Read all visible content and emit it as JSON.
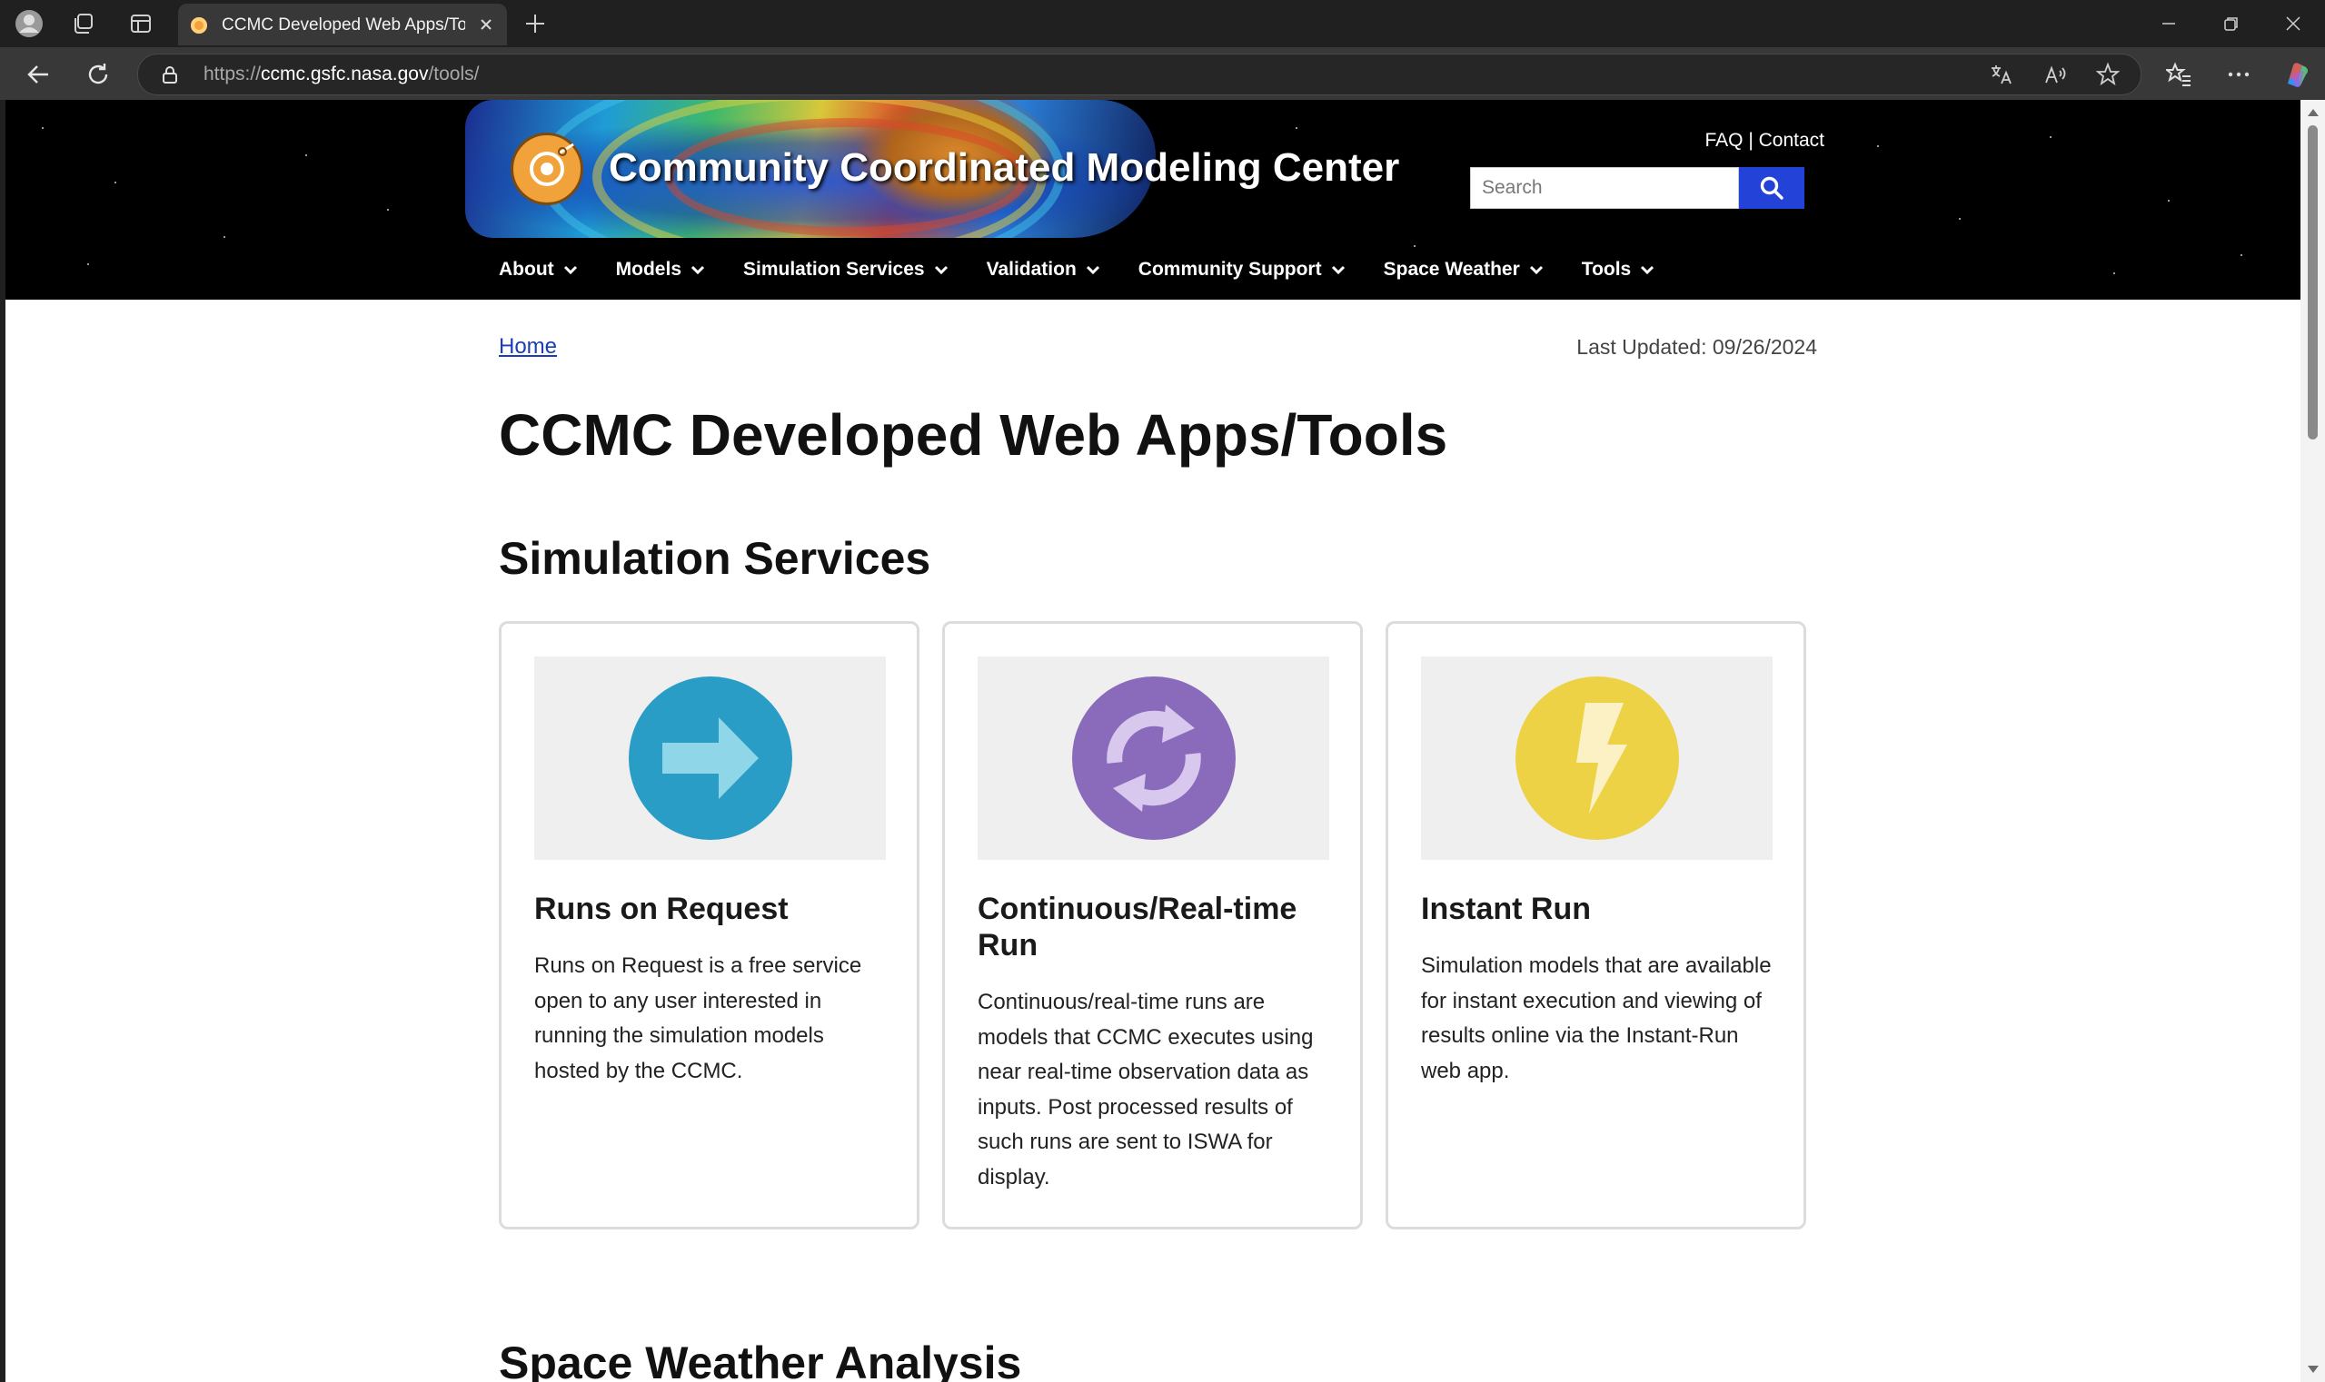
{
  "browser": {
    "tab_title": "CCMC Developed Web Apps/Tools",
    "url_prefix": "https://",
    "url_host": "ccmc.gsfc.nasa.gov",
    "url_path": "/tools/"
  },
  "header": {
    "site_title": "Community Coordinated Modeling Center",
    "faq": "FAQ",
    "separator": "|",
    "contact": "Contact",
    "search_placeholder": "Search"
  },
  "nav": [
    {
      "label": "About"
    },
    {
      "label": "Models"
    },
    {
      "label": "Simulation Services"
    },
    {
      "label": "Validation"
    },
    {
      "label": "Community Support"
    },
    {
      "label": "Space Weather"
    },
    {
      "label": "Tools"
    }
  ],
  "breadcrumb": "Home",
  "last_updated": "Last Updated: 09/26/2024",
  "page_title": "CCMC Developed Web Apps/Tools",
  "section1_title": "Simulation Services",
  "section2_title": "Space Weather Analysis",
  "cards": [
    {
      "title": "Runs on Request",
      "description": "Runs on Request is a free service open to any user interested in running the simulation models hosted by the CCMC.",
      "icon": "arrow-right-icon",
      "color": "#2a9dc6"
    },
    {
      "title": "Continuous/Real-time Run",
      "description": "Continuous/real-time runs are models that CCMC executes using near real-time observation data as inputs. Post processed results of such runs are sent to ISWA for display.",
      "icon": "refresh-icon",
      "color": "#8a6bbb"
    },
    {
      "title": "Instant Run",
      "description": "Simulation models that are available for instant execution and viewing of results online via the Instant-Run web app.",
      "icon": "lightning-icon",
      "color": "#ecd244"
    }
  ]
}
